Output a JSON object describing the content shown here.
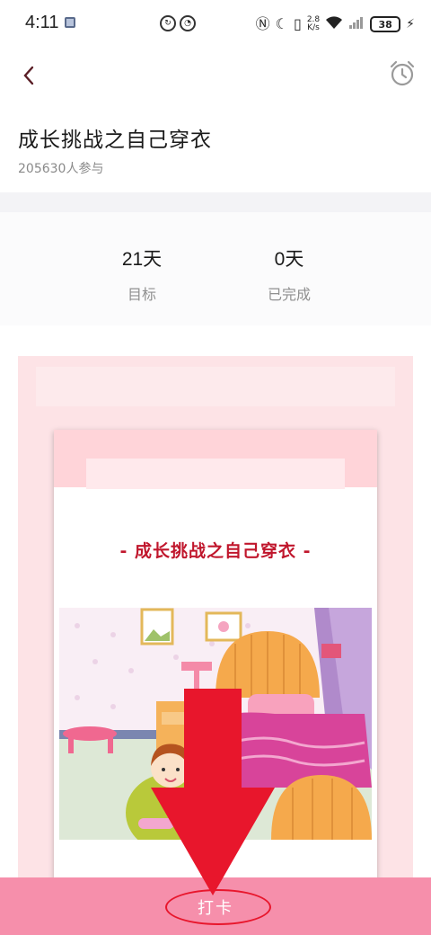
{
  "status_bar": {
    "time": "4:11",
    "net_speed_top": "2.8",
    "net_speed_bottom": "K/s",
    "battery": "38"
  },
  "nav": {
    "back_icon": "chevron-left-icon",
    "alarm_icon": "alarm-clock-icon"
  },
  "challenge": {
    "title": "成长挑战之自己穿衣",
    "participants": "205630人参与"
  },
  "stats": {
    "goal_value": "21天",
    "goal_label": "目标",
    "done_value": "0天",
    "done_label": "已完成"
  },
  "card": {
    "title": "- 成长挑战之自己穿衣 -"
  },
  "bottom": {
    "checkin_label": "打卡"
  },
  "colors": {
    "accent_pink": "#f68fab",
    "panel_pink": "#fde3e6",
    "card_title_red": "#c0162c",
    "annotation_red": "#e8162c"
  }
}
